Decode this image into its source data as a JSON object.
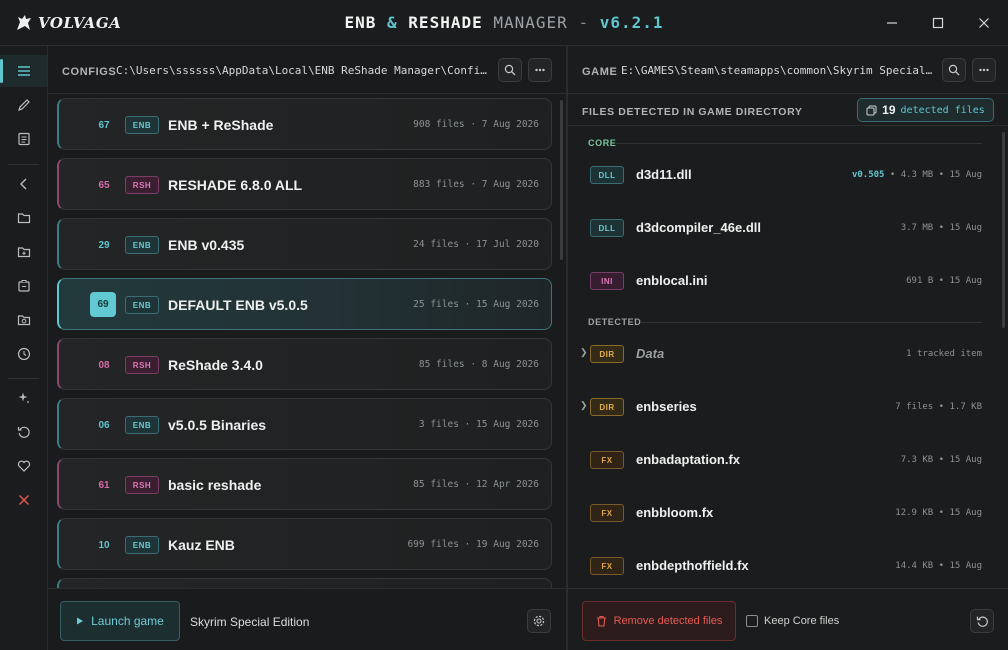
{
  "app": {
    "logo": "VOLVAGA",
    "title_part1": "ENB",
    "title_amp": "&",
    "title_part2": "RESHADE",
    "title_part3": "MANAGER",
    "title_dash": "-",
    "version": "v6.2.1"
  },
  "window": {
    "minimize_icon": "minimize-icon",
    "maximize_icon": "maximize-icon",
    "close_icon": "close-icon"
  },
  "sidebar": {
    "items": [
      {
        "icon": "menu-icon",
        "active": true
      },
      {
        "icon": "pencil-icon"
      },
      {
        "icon": "document-icon"
      },
      {
        "icon": "chevron-left-icon"
      },
      {
        "icon": "folder-icon"
      },
      {
        "icon": "folder-add-icon"
      },
      {
        "icon": "package-icon"
      },
      {
        "icon": "folder-game-icon"
      },
      {
        "icon": "clock-icon"
      },
      {
        "icon": "sparkle-icon"
      },
      {
        "icon": "restore-icon"
      },
      {
        "icon": "heart-icon"
      },
      {
        "icon": "x-icon"
      }
    ]
  },
  "configs": {
    "label": "CONFIGS",
    "path": "C:\\Users\\ssssss\\AppData\\Local\\ENB ReShade Manager\\Configs\\Skyrim Special Edition",
    "items": [
      {
        "num": "67",
        "type": "ENB",
        "name": "ENB + ReShade",
        "meta": "908 files · 7 Aug 2026"
      },
      {
        "num": "65",
        "type": "RSH",
        "name": "RESHADE 6.8.0 ALL",
        "meta": "883 files · 7 Aug 2026"
      },
      {
        "num": "29",
        "type": "ENB",
        "name": "ENB v0.435",
        "meta": "24 files · 17 Jul 2020"
      },
      {
        "num": "69",
        "type": "ENB",
        "name": "DEFAULT ENB v5.0.5",
        "meta": "25 files · 15 Aug 2026",
        "active": true
      },
      {
        "num": "08",
        "type": "RSH",
        "name": "ReShade 3.4.0",
        "meta": "85 files · 8 Aug 2026"
      },
      {
        "num": "06",
        "type": "ENB",
        "name": "v5.0.5 Binaries",
        "meta": "3 files · 15 Aug 2026"
      },
      {
        "num": "61",
        "type": "RSH",
        "name": "basic reshade",
        "meta": "85 files · 12 Apr 2026"
      },
      {
        "num": "10",
        "type": "ENB",
        "name": "Kauz ENB",
        "meta": "699 files · 19 Aug 2026"
      }
    ],
    "launch_label": "Launch game",
    "game_name": "Skyrim Special Edition"
  },
  "game": {
    "label": "GAME",
    "path": "E:\\GAMES\\Steam\\steamapps\\common\\Skyrim Special Edition",
    "files_header": "FILES DETECTED IN GAME DIRECTORY",
    "detected_count": "19",
    "detected_label": "detected files",
    "core_label": "CORE",
    "detected_section_label": "DETECTED",
    "core_files": [
      {
        "tag": "DLL",
        "name": "d3d11.dll",
        "version": "v0.505",
        "meta": "• 4.3 MB • 15 Aug"
      },
      {
        "tag": "DLL",
        "name": "d3dcompiler_46e.dll",
        "meta": "3.7 MB • 15 Aug"
      },
      {
        "tag": "INI",
        "name": "enblocal.ini",
        "meta": "691 B • 15 Aug"
      }
    ],
    "detected_files": [
      {
        "tag": "DIR",
        "name": "Data",
        "meta": "1 tracked item",
        "dim": true
      },
      {
        "tag": "DIR",
        "name": "enbseries",
        "meta": "7 files • 1.7 KB"
      },
      {
        "tag": "FX",
        "name": "enbadaptation.fx",
        "meta": "7.3 KB • 15 Aug"
      },
      {
        "tag": "FX",
        "name": "enbbloom.fx",
        "meta": "12.9 KB • 15 Aug"
      },
      {
        "tag": "FX",
        "name": "enbdepthoffield.fx",
        "meta": "14.4 KB • 15 Aug"
      }
    ],
    "remove_label": "Remove detected files",
    "keep_core_label": "Keep Core files"
  },
  "colors": {
    "accent": "#5fc6cf",
    "reshade": "#d86aa8",
    "danger": "#e85a55",
    "dir": "#e2b04a"
  }
}
